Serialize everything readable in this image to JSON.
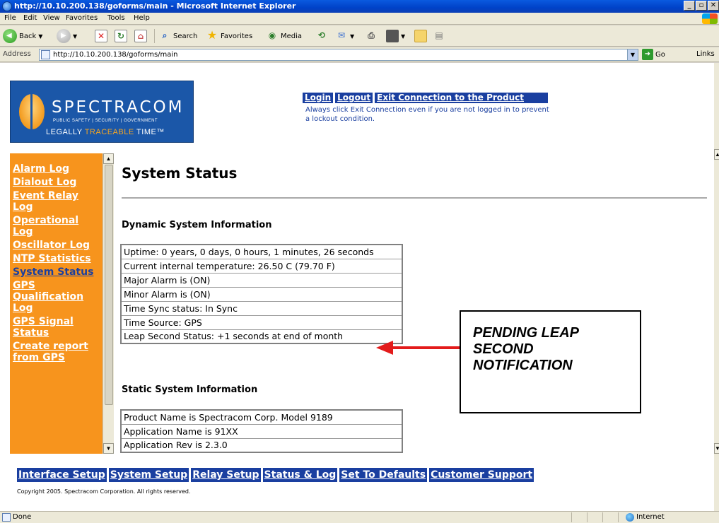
{
  "window": {
    "title": "http://10.10.200.138/goforms/main - Microsoft Internet Explorer"
  },
  "menu": [
    "File",
    "Edit",
    "View",
    "Favorites",
    "Tools",
    "Help"
  ],
  "toolbar": {
    "back": "Back",
    "search": "Search",
    "favorites": "Favorites",
    "media": "Media"
  },
  "address": {
    "label": "Address",
    "url": "http://10.10.200.138/goforms/main",
    "go": "Go",
    "links": "Links"
  },
  "header": {
    "logo_name": "SPECTRACOM",
    "logo_sub": "PUBLIC SAFETY | SECURITY | GOVERNMENT",
    "logo_tag_1": "LEGALLY ",
    "logo_tag_2": "TRACEABLE",
    "logo_tag_3": " TIME™",
    "links": [
      "Login",
      "Logout",
      "Exit Connection to the Product"
    ],
    "note": "Always click Exit Connection even if you are not logged in to prevent a lockout condition."
  },
  "sidebar": {
    "items": [
      "Alarm Log",
      "Dialout Log",
      "Event Relay Log",
      "Operational Log",
      "Oscillator Log",
      "NTP Statistics",
      "System Status",
      "GPS Qualification Log",
      "GPS Signal Status",
      "Create report from GPS"
    ]
  },
  "main": {
    "title": "System Status",
    "dynamic_heading": "Dynamic System Information",
    "dynamic_rows": [
      "Uptime: 0 years, 0 days, 0 hours, 1 minutes, 26 seconds",
      "Current internal temperature: 26.50 C (79.70 F)",
      "Major Alarm is (ON)",
      "Minor Alarm is (ON)",
      "Time Sync status: In Sync",
      "Time Source: GPS",
      "Leap Second Status: +1 seconds at end of month"
    ],
    "static_heading": "Static System Information",
    "static_rows": [
      "Product Name is Spectracom Corp. Model 9189",
      "Application Name is 91XX",
      "Application Rev is 2.3.0"
    ]
  },
  "annotation": {
    "line1": "PENDING LEAP",
    "line2": "SECOND",
    "line3": "NOTIFICATION",
    "arrow_color": "#e31b1b"
  },
  "bottom_nav": [
    "Interface Setup",
    "System Setup",
    "Relay Setup",
    "Status & Log",
    "Set To Defaults",
    "Customer Support"
  ],
  "footer": {
    "copyright": "Copyright 2005. Spectracom Corporation. All rights reserved."
  },
  "status": {
    "text": "Done",
    "zone": "Internet"
  },
  "colors": {
    "nav_blue": "#1a3fa0",
    "sidebar_orange": "#f7941d",
    "logo_blue": "#1b57a8"
  }
}
